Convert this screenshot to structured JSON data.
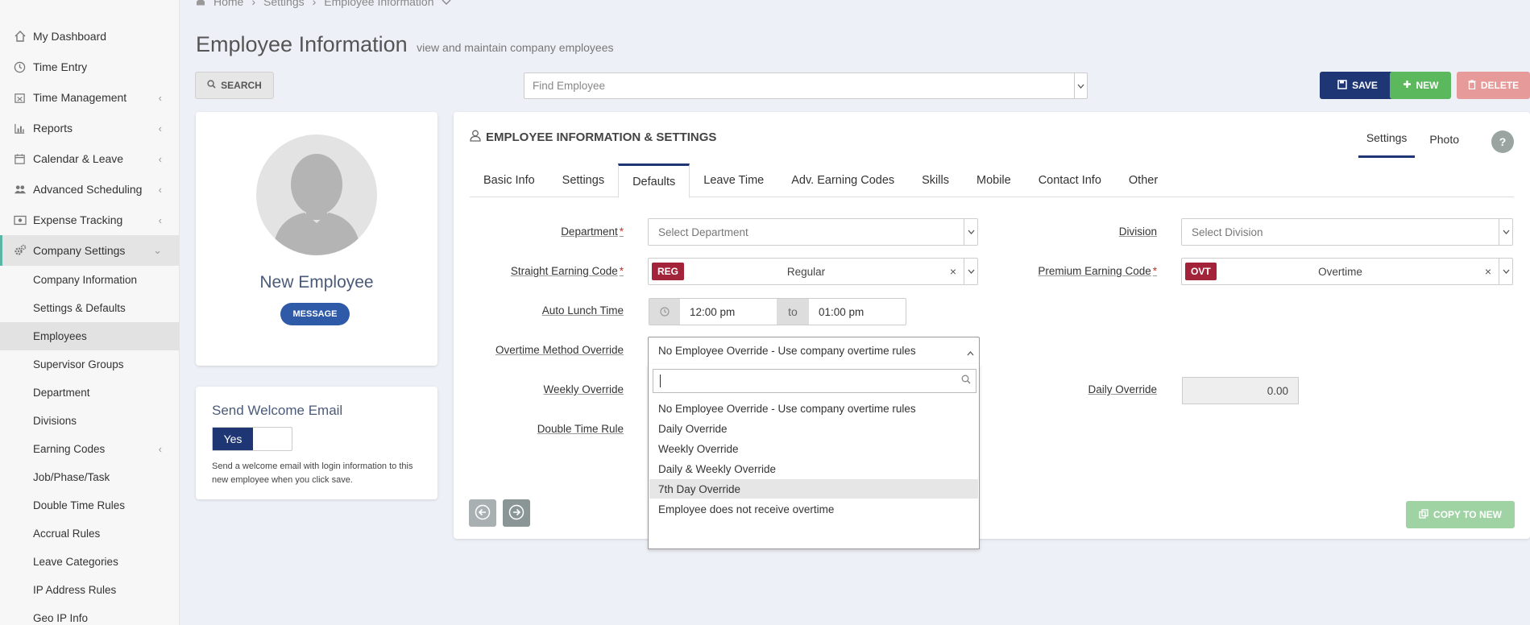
{
  "sidebar": {
    "items": [
      {
        "label": "My Dashboard",
        "icon": "home-icon",
        "chevron": ""
      },
      {
        "label": "Time Entry",
        "icon": "clock-icon",
        "chevron": ""
      },
      {
        "label": "Time Management",
        "icon": "calendar-x-icon",
        "chevron": "‹"
      },
      {
        "label": "Reports",
        "icon": "bar-chart-icon",
        "chevron": "‹"
      },
      {
        "label": "Calendar & Leave",
        "icon": "calendar-icon",
        "chevron": "‹"
      },
      {
        "label": "Advanced Scheduling",
        "icon": "users-icon",
        "chevron": "‹"
      },
      {
        "label": "Expense Tracking",
        "icon": "money-icon",
        "chevron": "‹"
      },
      {
        "label": "Company Settings",
        "icon": "gears-icon",
        "chevron": "⌄"
      }
    ],
    "sub_items": [
      {
        "label": "Company Information",
        "chevron": ""
      },
      {
        "label": "Settings & Defaults",
        "chevron": ""
      },
      {
        "label": "Employees",
        "chevron": ""
      },
      {
        "label": "Supervisor Groups",
        "chevron": ""
      },
      {
        "label": "Department",
        "chevron": ""
      },
      {
        "label": "Divisions",
        "chevron": ""
      },
      {
        "label": "Earning Codes",
        "chevron": "‹"
      },
      {
        "label": "Job/Phase/Task",
        "chevron": ""
      },
      {
        "label": "Double Time Rules",
        "chevron": ""
      },
      {
        "label": "Accrual Rules",
        "chevron": ""
      },
      {
        "label": "Leave Categories",
        "chevron": ""
      },
      {
        "label": "IP Address Rules",
        "chevron": ""
      },
      {
        "label": "Geo IP Info",
        "chevron": ""
      }
    ]
  },
  "breadcrumb": {
    "home": "Home",
    "sep": "›",
    "settings": "Settings",
    "current": "Employee Information"
  },
  "header": {
    "title": "Employee Information",
    "subtitle": "view and maintain company employees"
  },
  "toolbar": {
    "search_label": "SEARCH",
    "find_placeholder": "Find Employee",
    "save_label": "SAVE",
    "new_label": "NEW",
    "delete_label": "DELETE"
  },
  "profile": {
    "name": "New Employee",
    "message_label": "MESSAGE"
  },
  "welcome": {
    "title": "Send Welcome Email",
    "toggle_value": "Yes",
    "description": "Send a welcome email with login information to this new employee when you click save."
  },
  "panel": {
    "title": "EMPLOYEE INFORMATION & SETTINGS",
    "right_tabs": [
      "Settings",
      "Photo"
    ],
    "help": "?",
    "tabs": [
      "Basic Info",
      "Settings",
      "Defaults",
      "Leave Time",
      "Adv. Earning Codes",
      "Skills",
      "Mobile",
      "Contact Info",
      "Other"
    ],
    "active_tab": "Defaults"
  },
  "form": {
    "department_label": "Department",
    "department_placeholder": "Select Department",
    "division_label": "Division",
    "division_placeholder": "Select Division",
    "straight_label": "Straight Earning Code",
    "straight_code": "REG",
    "straight_value": "Regular",
    "premium_label": "Premium Earning Code",
    "premium_code": "OVT",
    "premium_value": "Overtime",
    "lunch_label": "Auto Lunch Time",
    "lunch_start": "12:00 pm",
    "lunch_to": "to",
    "lunch_end": "01:00 pm",
    "ot_label": "Overtime Method Override",
    "ot_value": "No Employee Override - Use company overtime rules",
    "weekly_label": "Weekly Override",
    "daily_label": "Daily Override",
    "daily_value": "0.00",
    "double_label": "Double Time Rule",
    "required_mark": "*",
    "clear": "×"
  },
  "dropdown": {
    "options": [
      "No Employee Override - Use company overtime rules",
      "Daily Override",
      "Weekly Override",
      "Daily & Weekly Override",
      "7th Day Override",
      "Employee does not receive overtime"
    ],
    "highlighted": "7th Day Override"
  },
  "footer": {
    "copy_label": "COPY TO NEW"
  },
  "colors": {
    "primary": "#1f3674",
    "success": "#5cb85c",
    "danger": "#e79a9a",
    "code_badge": "#a3233a",
    "accent": "#5ab5a5"
  }
}
